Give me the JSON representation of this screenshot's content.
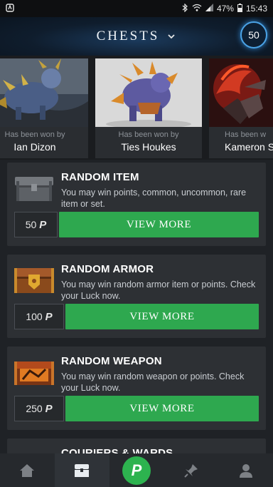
{
  "status_bar": {
    "battery": "47%",
    "time": "15:43",
    "icons": [
      "app-notification-icon",
      "bluetooth-icon",
      "wifi-icon",
      "signal-icon",
      "battery-icon"
    ]
  },
  "header": {
    "title": "CHESTS",
    "points": "50"
  },
  "winners": [
    {
      "caption": "Has been won by",
      "name": "Ian Dizon"
    },
    {
      "caption": "Has been won by",
      "name": "Ties Houkes"
    },
    {
      "caption": "Has been w",
      "name": "Kameron Sc"
    }
  ],
  "chests": [
    {
      "title": "RANDOM ITEM",
      "description": "You may win points, common, uncommon, rare item or set.",
      "price": "50",
      "button": "VIEW MORE",
      "icon": "grey-chest-icon"
    },
    {
      "title": "RANDOM ARMOR",
      "description": "You may win random armor item or points. Check your Luck now.",
      "price": "100",
      "button": "VIEW MORE",
      "icon": "armor-chest-icon"
    },
    {
      "title": "RANDOM WEAPON",
      "description": "You may win random weapon or points. Check your Luck now.",
      "price": "250",
      "button": "VIEW MORE",
      "icon": "weapon-chest-icon"
    },
    {
      "title": "COURIERS & WARDS",
      "icon": "courier-chest-icon"
    }
  ],
  "price_symbol": "P",
  "nav": {
    "items": [
      "home-icon",
      "chest-icon",
      "points-icon",
      "pin-icon",
      "profile-icon"
    ],
    "center_label": "P",
    "active_index": 1
  },
  "colors": {
    "accent_green": "#2ea84f",
    "badge_blue": "#4ba3e6",
    "card_bg": "#2d3034",
    "page_bg": "#1f2226"
  }
}
